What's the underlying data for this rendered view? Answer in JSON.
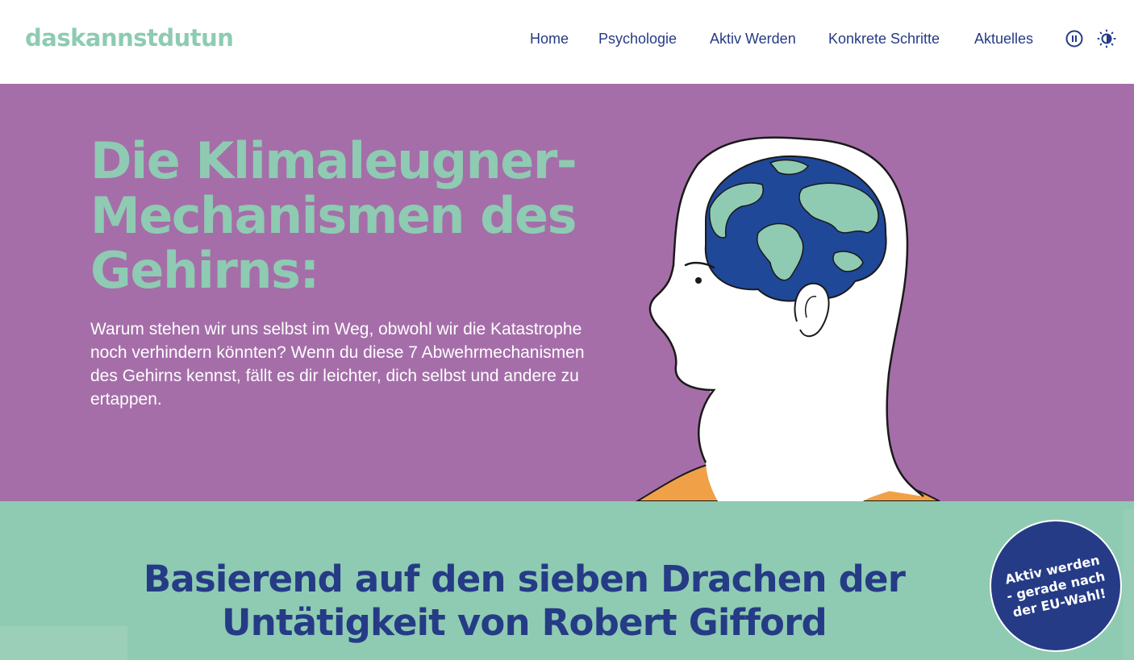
{
  "site": {
    "logo": "daskannstdutun"
  },
  "nav": {
    "items": [
      {
        "label": "Home"
      },
      {
        "label": "Psychologie"
      },
      {
        "label": "Aktiv Werden"
      },
      {
        "label": "Konkrete Schritte"
      },
      {
        "label": "Aktuelles"
      }
    ],
    "icons": [
      "pause-circle-icon",
      "contrast-toggle-icon"
    ]
  },
  "hero": {
    "title": "Die Klimaleugner-Mechanismen des Gehirns:",
    "text": "Warum stehen wir uns selbst im Weg, obwohl wir die Katastrophe noch verhindern könnten? Wenn du diese 7 Abwehrmechanismen des Gehirns kennst, fällt es dir leichter, dich selbst und andere zu ertappen.",
    "illustration": "head-with-globe-brain-illustration"
  },
  "section2": {
    "title": "Basierend auf den sieben Drachen der Untätigkeit von Robert Gifford"
  },
  "badge": {
    "lines": [
      "Aktiv werden",
      "- gerade nach",
      "der EU-Wahl!"
    ]
  },
  "colors": {
    "mint": "#8ecbb2",
    "purple": "#a56ea9",
    "navy": "#253b86",
    "orange": "#f0a148",
    "white": "#ffffff"
  }
}
